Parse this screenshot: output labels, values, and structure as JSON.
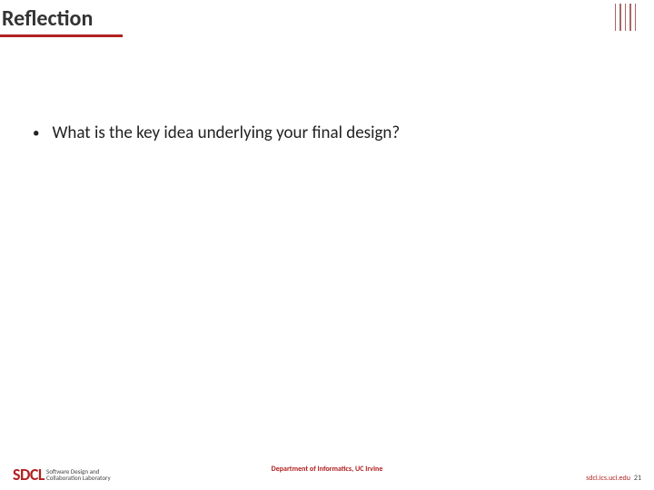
{
  "title": "Reflection",
  "bullets": [
    "What is the key idea underlying your final design?"
  ],
  "footer": {
    "logo": "SDCL",
    "logo_sub1": "Software Design and",
    "logo_sub2": "Collaboration Laboratory",
    "center": "Department of Informatics, UC Irvine",
    "url": "sdcl.ics.uci.edu",
    "page": "21"
  }
}
